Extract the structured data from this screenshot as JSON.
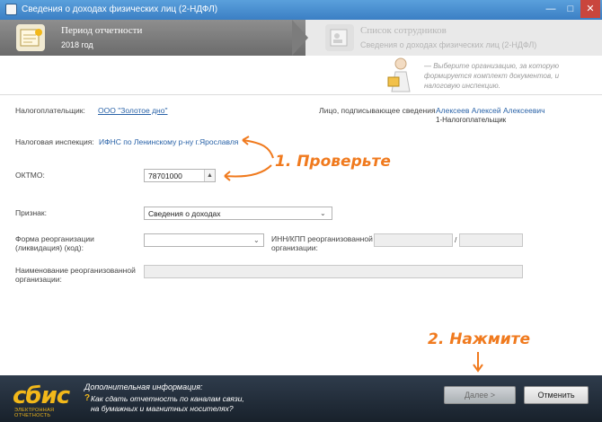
{
  "window": {
    "title": "Сведения о доходах физических лиц (2-НДФЛ)",
    "minimize": "—",
    "maximize": "□",
    "close": "✕"
  },
  "steps": [
    {
      "title": "Период отчетности",
      "subtitle": "2018 год",
      "active": true
    },
    {
      "title": "Список сотрудников",
      "subtitle": "Сведения о доходах физических лиц (2-НДФЛ)",
      "active": false
    }
  ],
  "hint": {
    "line1": "— Выберите организацию, за которую",
    "line2": "формируется комплект документов, и",
    "line3": "налоговую инспекцию."
  },
  "form": {
    "taxpayer_label": "Налогоплательщик:",
    "taxpayer_value": "ООО \"Золотое дно\"",
    "signer_label": "Лицо, подписывающее сведения",
    "signer_value": "Алексеев Алексей Алексеевич",
    "signer_sub": "1-Налогоплательщик",
    "inspection_label": "Налоговая инспекция:",
    "inspection_value": "ИФНС по Ленинскому р-ну г.Ярославля",
    "oktmo_label": "ОКТМО:",
    "oktmo_value": "78701000",
    "sign_label": "Признак:",
    "sign_value": "Сведения о доходах",
    "reorg_form_label_1": "Форма реорганизации",
    "reorg_form_label_2": "(ликвидация) (код):",
    "reorg_form_value": "",
    "inn_kpp_label_1": "ИНН/КПП реорганизованной",
    "inn_kpp_label_2": "организации:",
    "inn_kpp_sep": "/",
    "reorg_name_label_1": "Наименование реорганизованной",
    "reorg_name_label_2": "организации:"
  },
  "annotations": {
    "check": "1. Проверьте",
    "press": "2. Нажмите"
  },
  "footer": {
    "logo": "сбис",
    "logo_sub": "ЭЛЕКТРОННАЯ ОТЧЕТНОСТЬ",
    "info_title": "Дополнительная информация:",
    "info_q": "?",
    "info_link_1": "Как сдать отчетность по каналам связи,",
    "info_link_2": "на бумажных и магнитных носителях?",
    "next": "Далее >",
    "cancel": "Отменить"
  },
  "colors": {
    "accent_orange": "#f07a1e",
    "link_blue": "#2a63a8",
    "logo_yellow": "#f2b81a",
    "titlebar_blue": "#3b7fc4"
  }
}
